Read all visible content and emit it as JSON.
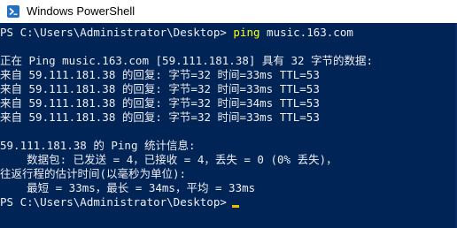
{
  "window": {
    "title": "Windows PowerShell",
    "icon": "powershell-icon",
    "colors": {
      "background": "#012456",
      "text": "#eeedf0",
      "command": "#ffff00",
      "cursor": "#f0c000"
    }
  },
  "console": {
    "prompt1": {
      "prompt": "PS C:\\Users\\Administrator\\Desktop>",
      "command": "ping",
      "argument": "music.163.com"
    },
    "ping_header": "正在 Ping music.163.com [59.111.181.38] 具有 32 字节的数据:",
    "replies": [
      "来自 59.111.181.38 的回复: 字节=32 时间=33ms TTL=53",
      "来自 59.111.181.38 的回复: 字节=32 时间=33ms TTL=53",
      "来自 59.111.181.38 的回复: 字节=32 时间=34ms TTL=53",
      "来自 59.111.181.38 的回复: 字节=32 时间=33ms TTL=53"
    ],
    "stats_header": "59.111.181.38 的 Ping 统计信息:",
    "stats_packets": "    数据包: 已发送 = 4，已接收 = 4，丢失 = 0 (0% 丢失)，",
    "rtt_header": "往返行程的估计时间(以毫秒为单位):",
    "rtt_values": "    最短 = 33ms，最长 = 34ms，平均 = 33ms",
    "prompt2": {
      "prompt": "PS C:\\Users\\Administrator\\Desktop>"
    }
  }
}
